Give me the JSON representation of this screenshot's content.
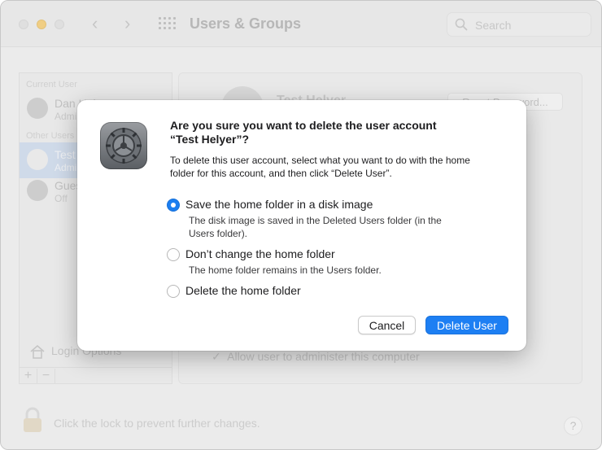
{
  "window": {
    "title": "Users & Groups",
    "search_placeholder": "Search"
  },
  "sidebar": {
    "current_user_header": "Current User",
    "other_users_header": "Other Users",
    "users": [
      {
        "name": "Dan Helyer",
        "role": "Admin"
      },
      {
        "name": "Test Helyer",
        "role": "Admin"
      },
      {
        "name": "Guest User",
        "role": "Off"
      }
    ],
    "login_options_label": "Login Options",
    "add_label": "+",
    "remove_label": "−"
  },
  "panel": {
    "user_name": "Test Helyer",
    "reset_password_label": "Reset Password...",
    "allow_admin_label": "Allow user to administer this computer"
  },
  "footer": {
    "lock_text": "Click the lock to prevent further changes.",
    "help_label": "?"
  },
  "dialog": {
    "title_line1": "Are you sure you want to delete the user account",
    "title_line2": "“Test Helyer”?",
    "message_line1": "To delete this user account, select what you want to do with the home",
    "message_line2": "folder for this account, and then click “Delete User”.",
    "options": [
      {
        "label": "Save the home folder in a disk image",
        "selected": true,
        "desc_line1": "The disk image is saved in the Deleted Users folder (in the",
        "desc_line2": "Users folder)."
      },
      {
        "label": "Don’t change the home folder",
        "selected": false,
        "desc_line1": "The home folder remains in the Users folder."
      },
      {
        "label": "Delete the home folder",
        "selected": false
      }
    ],
    "cancel_label": "Cancel",
    "confirm_label": "Delete User"
  },
  "colors": {
    "accent": "#1d7ff3",
    "window_bg": "#ececec",
    "minimize_light": "#f5b731"
  }
}
